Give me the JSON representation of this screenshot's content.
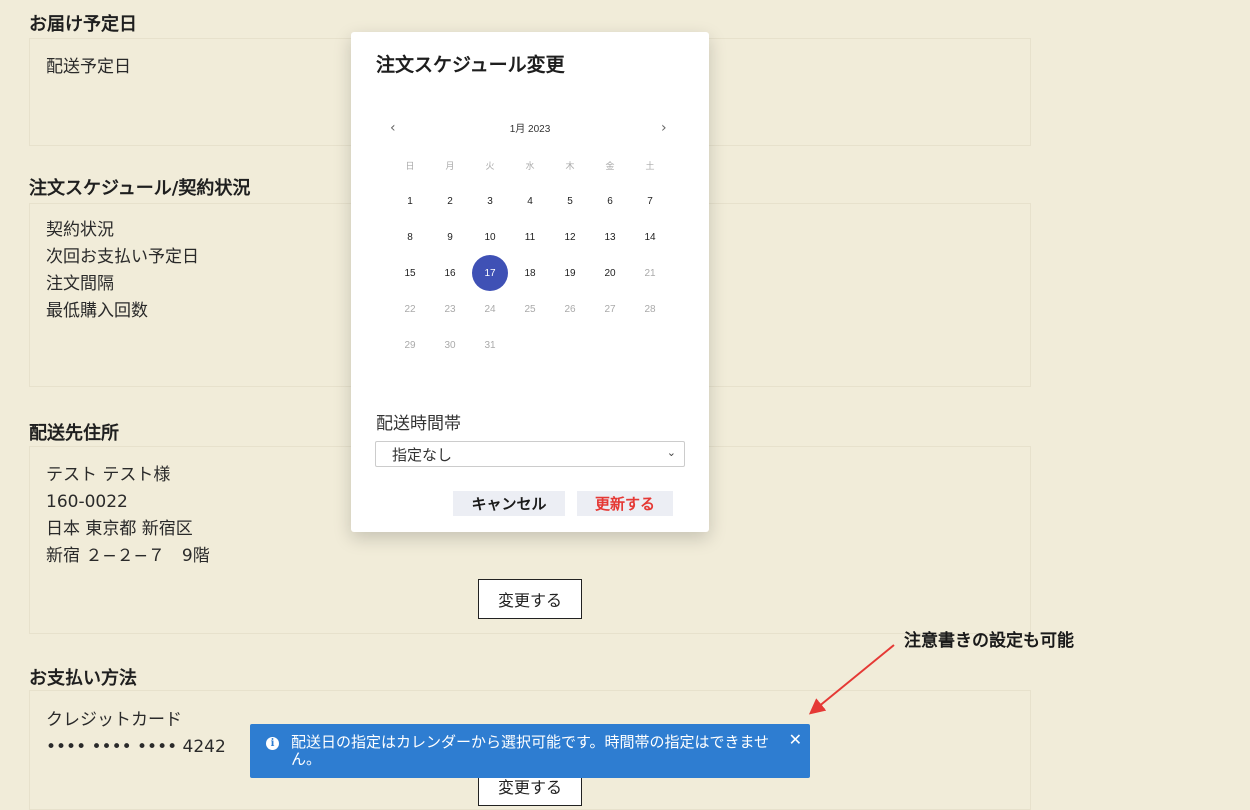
{
  "sections": {
    "delivery_date": {
      "title": "お届け予定日",
      "lines": [
        "配送予定日"
      ]
    },
    "schedule": {
      "title": "注文スケジュール/契約状況",
      "lines": [
        "契約状況",
        "次回お支払い予定日",
        "注文間隔",
        "最低購入回数"
      ]
    },
    "address": {
      "title": "配送先住所",
      "lines": [
        "テスト テスト様",
        "160-0022",
        "日本 東京都 新宿区",
        "新宿 ２−２−７　9階"
      ],
      "change_label": "変更する"
    },
    "payment": {
      "title": "お支払い方法",
      "lines": [
        "クレジットカード",
        "•••• •••• •••• 4242"
      ],
      "change_label": "変更する"
    }
  },
  "modal": {
    "title": "注文スケジュール変更",
    "calendar": {
      "month_label": "1月 2023",
      "prev": "‹",
      "next": "›",
      "weekdays": [
        "日",
        "月",
        "火",
        "水",
        "木",
        "金",
        "土"
      ],
      "weeks": [
        [
          "1",
          "2",
          "3",
          "4",
          "5",
          "6",
          "7"
        ],
        [
          "8",
          "9",
          "10",
          "11",
          "12",
          "13",
          "14"
        ],
        [
          "15",
          "16",
          "17",
          "18",
          "19",
          "20",
          "21"
        ],
        [
          "22",
          "23",
          "24",
          "25",
          "26",
          "27",
          "28"
        ],
        [
          "29",
          "30",
          "31",
          "",
          "",
          "",
          ""
        ]
      ],
      "selected": "17",
      "enabled_days": [
        "1",
        "2",
        "3",
        "4",
        "5",
        "6",
        "7",
        "8",
        "9",
        "10",
        "11",
        "12",
        "13",
        "14",
        "15",
        "16",
        "17",
        "18",
        "19",
        "20"
      ],
      "selected_color": "#3f51b5"
    },
    "time_label": "配送時間帯",
    "time_value": "指定なし",
    "cancel_label": "キャンセル",
    "update_label": "更新する",
    "update_color": "#e53935"
  },
  "toast": {
    "icon": "i",
    "message": "配送日の指定はカレンダーから選択可能です。時間帯の指定はできません。",
    "close": "✕",
    "color": "#2e7dd1"
  },
  "annotation": {
    "text": "注意書きの設定も可能",
    "arrow_color": "#e53935"
  }
}
